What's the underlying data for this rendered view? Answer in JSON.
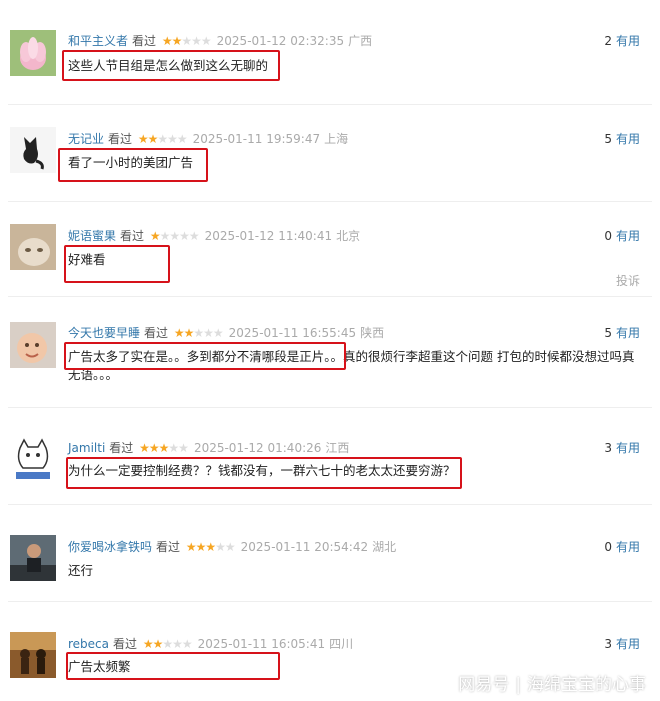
{
  "votes_label": "有用",
  "report_label": "投诉",
  "watched_label": "看过",
  "colors": {
    "highlight": "#d6121a",
    "user": "#3377aa",
    "star_on": "#f6a623"
  },
  "comments": [
    {
      "user": "和平主义者",
      "stars": 2,
      "time": "2025-01-12 02:32:35",
      "location": "广西",
      "votes": "2",
      "content": "这些人节目组是怎么做到这么无聊的",
      "avatar_icon": "lotus-flower-avatar"
    },
    {
      "user": "无记业",
      "stars": 2,
      "time": "2025-01-11 19:59:47",
      "location": "上海",
      "votes": "5",
      "content": "看了一小时的美团广告",
      "avatar_icon": "black-cat-avatar"
    },
    {
      "user": "妮语蜜果",
      "stars": 1,
      "time": "2025-01-12 11:40:41",
      "location": "北京",
      "votes": "0",
      "content": "好难看",
      "avatar_icon": "cat-photo-avatar"
    },
    {
      "user": "今天也要早睡",
      "stars": 2,
      "time": "2025-01-11 16:55:45",
      "location": "陕西",
      "votes": "5",
      "content": "广告太多了实在是。。多到都分不清哪段是正片。。真的很烦行李超重这个问题 打包的时候都没想过吗真无语。。。",
      "avatar_icon": "baby-avatar"
    },
    {
      "user": "Jamilti",
      "stars": 3,
      "time": "2025-01-12 01:40:26",
      "location": "江西",
      "votes": "3",
      "content": "为什么一定要控制经费？？钱都没有，一群六七十的老太太还要穷游？",
      "avatar_icon": "cartoon-cat-avatar"
    },
    {
      "user": "你爱喝冰拿铁吗",
      "stars": 3,
      "time": "2025-01-11 20:54:42",
      "location": "湖北",
      "votes": "0",
      "content": "还行",
      "avatar_icon": "person-photo-avatar"
    },
    {
      "user": "rebeca",
      "stars": 2,
      "time": "2025-01-11 16:05:41",
      "location": "四川",
      "votes": "3",
      "content": "广告太频繁",
      "avatar_icon": "figures-photo-avatar"
    }
  ],
  "watermark": {
    "brand": "网易号",
    "separator": "|",
    "author": "海绵宝宝的心事"
  }
}
